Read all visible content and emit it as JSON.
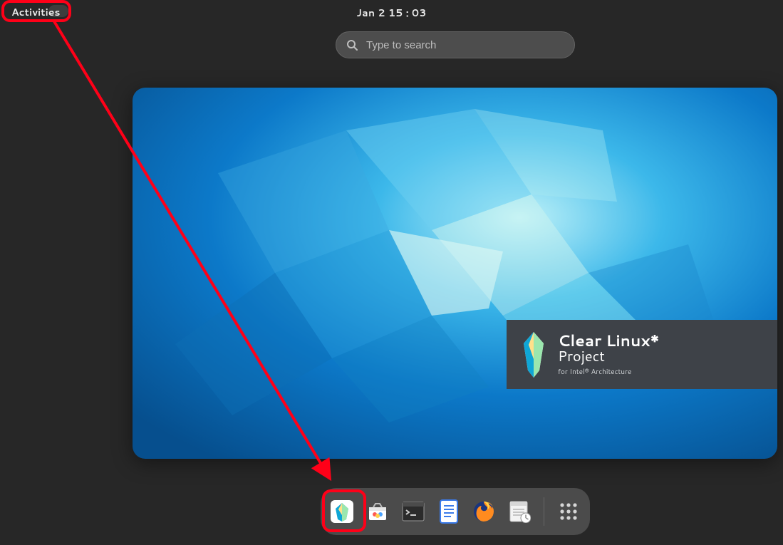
{
  "topbar": {
    "activities_label": "Activities",
    "datetime": "Jan 2  15 : 03"
  },
  "search": {
    "placeholder": "Type to search",
    "value": ""
  },
  "branding": {
    "title": "Clear Linux*",
    "subtitle": "Project",
    "tagline": "for Intel® Architecture"
  },
  "dash": {
    "items": [
      {
        "name": "clear-linux-installer-icon"
      },
      {
        "name": "software-center-icon"
      },
      {
        "name": "terminal-icon"
      },
      {
        "name": "text-editor-icon"
      },
      {
        "name": "firefox-icon"
      },
      {
        "name": "evolution-mail-icon"
      }
    ],
    "apps_button": "Show Applications"
  },
  "annotations": {
    "highlight": [
      {
        "target": "activities-button"
      },
      {
        "target": "dash-item-0"
      }
    ],
    "arrow": {
      "from": "activities-button",
      "to": "dash-item-0"
    }
  }
}
